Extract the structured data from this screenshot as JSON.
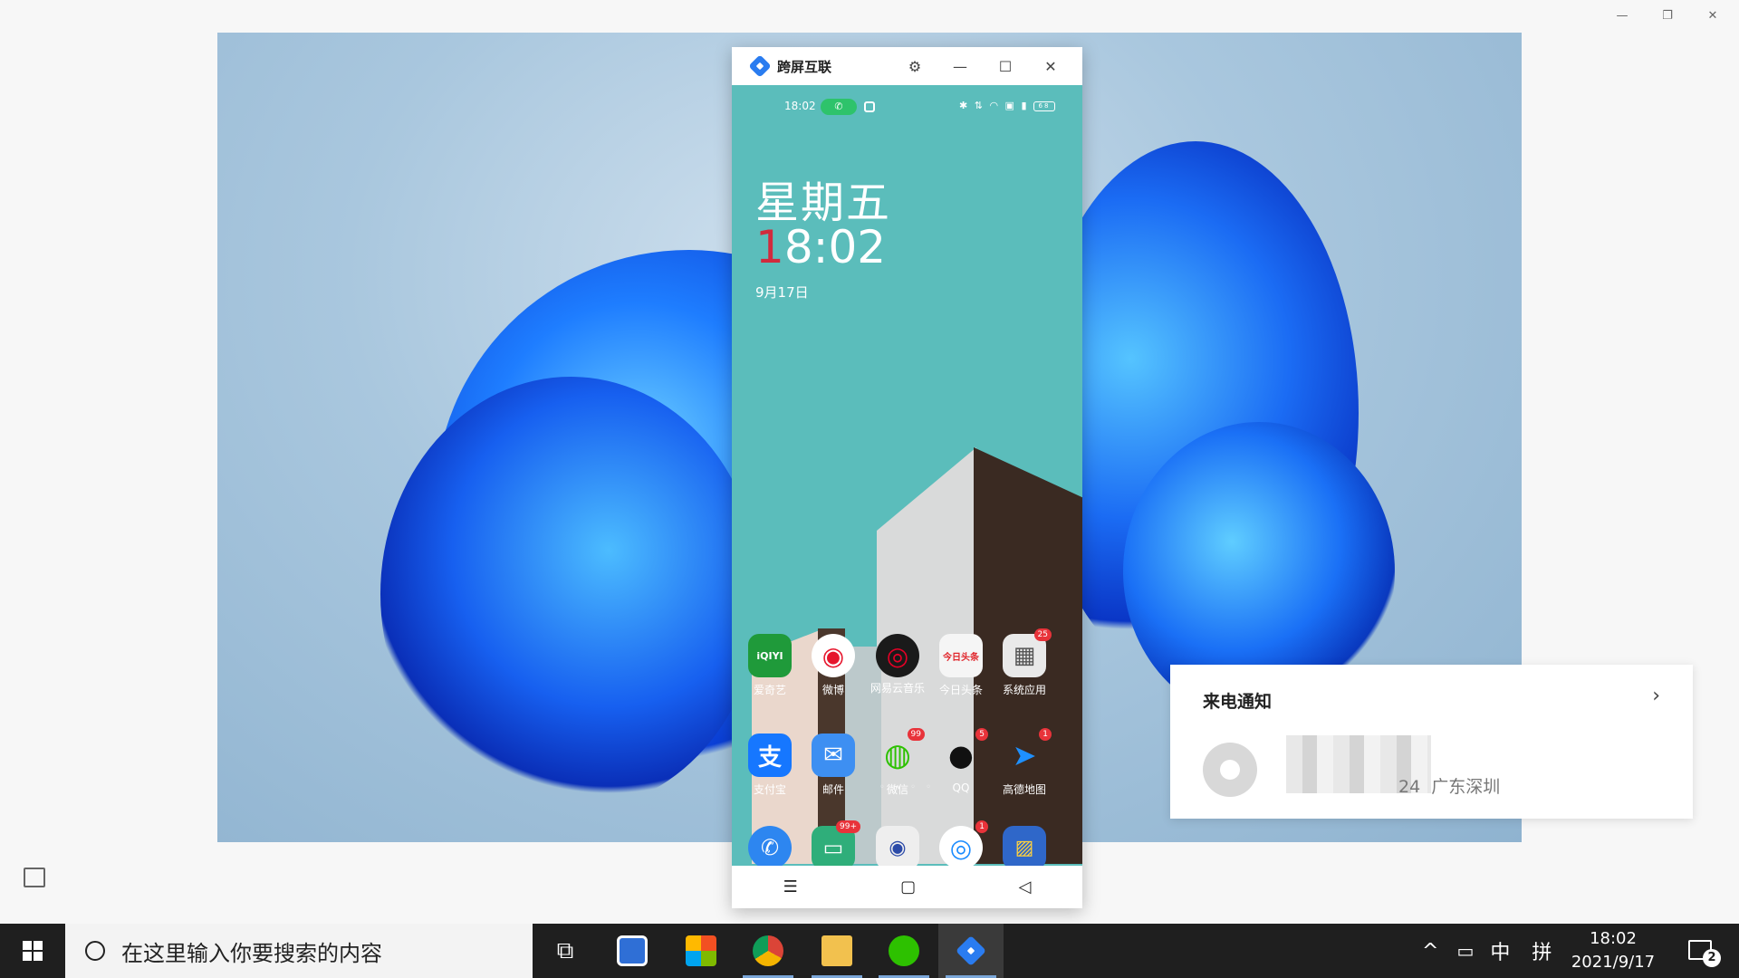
{
  "outer_window": {
    "minimize": "—",
    "restore": "❐",
    "close": "✕"
  },
  "phone_window": {
    "title": "跨屏互联",
    "settings_icon": "⚙",
    "minimize": "—",
    "maximize": "☐",
    "close": "✕"
  },
  "phone": {
    "status_time": "18:02",
    "call_pill": "✆",
    "status_icons": "✱ ⇅ ◠ ▣ ▮",
    "battery": "68",
    "weekday": "星期五",
    "clock_first": "1",
    "clock_rest": "8:02",
    "date": "9月17日",
    "apps_row1": [
      {
        "label": "爱奇艺",
        "glyph": "iQIYI",
        "color": "#1f9a3a",
        "badge": ""
      },
      {
        "label": "微博",
        "glyph": "◉",
        "color": "#ffffff",
        "badge": ""
      },
      {
        "label": "网易云音乐",
        "glyph": "◎",
        "color": "#1a1a1a",
        "badge": ""
      },
      {
        "label": "今日头条",
        "glyph": "今日头条",
        "color": "#f5f5f5",
        "badge": ""
      },
      {
        "label": "系统应用",
        "glyph": "▦",
        "color": "#e9e9e9",
        "badge": "25"
      }
    ],
    "apps_row2": [
      {
        "label": "支付宝",
        "glyph": "支",
        "color": "#1677ff",
        "badge": ""
      },
      {
        "label": "邮件",
        "glyph": "✉",
        "color": "#3d8ff2",
        "badge": ""
      },
      {
        "label": "微信",
        "glyph": "◍",
        "color": "#ffffff",
        "badge": "99"
      },
      {
        "label": "QQ",
        "glyph": "●",
        "color": "#ffffff",
        "badge": "5"
      },
      {
        "label": "高德地图",
        "glyph": "➤",
        "color": "#ffffff",
        "badge": "1"
      }
    ],
    "page_dots": "◦ • ◦ ◦",
    "dock": [
      {
        "glyph": "✆",
        "color": "#2d86f0",
        "badge": ""
      },
      {
        "glyph": "▭",
        "color": "#2fae7a",
        "badge": "99+"
      },
      {
        "glyph": "◉",
        "color": "#eeeeee",
        "badge": ""
      },
      {
        "glyph": "◎",
        "color": "#ffffff",
        "badge": "1"
      },
      {
        "glyph": "▨",
        "color": "#2f67c9",
        "badge": ""
      }
    ],
    "nav": {
      "menu": "☰",
      "home": "▢",
      "back": "◁"
    }
  },
  "notification": {
    "title": "来电通知",
    "chevron": "›",
    "number_suffix": "24",
    "location": "广东深圳"
  },
  "taskbar": {
    "search_placeholder": "在这里输入你要搜索的内容",
    "task_view": "⧉",
    "tray_up": "^",
    "tray_battery": "▭",
    "ime_lang": "中",
    "ime_mode": "拼",
    "time": "18:02",
    "date": "2021/9/17",
    "notification_count": "2"
  }
}
